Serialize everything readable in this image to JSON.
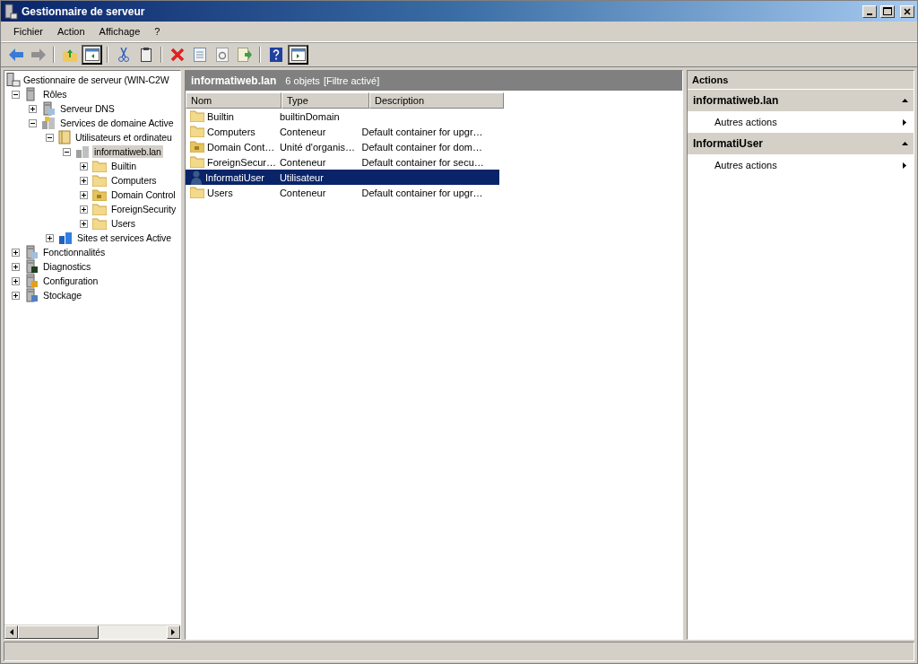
{
  "window": {
    "title": "Gestionnaire de serveur"
  },
  "menu": [
    "Fichier",
    "Action",
    "Affichage",
    "?"
  ],
  "toolbar": [
    {
      "kind": "back",
      "pressed": false,
      "disabled": false
    },
    {
      "kind": "forward",
      "pressed": false,
      "disabled": true
    },
    {
      "kind": "separator"
    },
    {
      "kind": "up",
      "pressed": false
    },
    {
      "kind": "tree",
      "pressed": true
    },
    {
      "kind": "separator"
    },
    {
      "kind": "cut",
      "pressed": false
    },
    {
      "kind": "paste",
      "pressed": false
    },
    {
      "kind": "separator"
    },
    {
      "kind": "delete",
      "pressed": false
    },
    {
      "kind": "properties",
      "pressed": false
    },
    {
      "kind": "refresh",
      "pressed": false
    },
    {
      "kind": "export",
      "pressed": false
    },
    {
      "kind": "separator"
    },
    {
      "kind": "help",
      "pressed": false
    },
    {
      "kind": "actionpane",
      "pressed": true
    }
  ],
  "tree": [
    {
      "label": "Gestionnaire de serveur (WIN-C2W",
      "kind": "server",
      "selected": false,
      "children": [
        {
          "label": "Rôles",
          "kind": "roles",
          "expanded": true,
          "selected": false,
          "children": [
            {
              "label": "Serveur DNS",
              "kind": "dns",
              "expanded": false,
              "selected": false
            },
            {
              "label": "Services de domaine Active",
              "kind": "ad",
              "expanded": true,
              "selected": false,
              "children": [
                {
                  "label": "Utilisateurs et ordinateu",
                  "kind": "book",
                  "expanded": true,
                  "selected": false,
                  "children": [
                    {
                      "label": "informatiweb.lan",
                      "kind": "domain",
                      "expanded": true,
                      "selected": true,
                      "children": [
                        {
                          "label": "Builtin",
                          "kind": "folder",
                          "expanded": false,
                          "selected": false
                        },
                        {
                          "label": "Computers",
                          "kind": "folder",
                          "expanded": false,
                          "selected": false
                        },
                        {
                          "label": "Domain Control",
                          "kind": "ou",
                          "expanded": false,
                          "selected": false
                        },
                        {
                          "label": "ForeignSecurity",
                          "kind": "folder",
                          "expanded": false,
                          "selected": false
                        },
                        {
                          "label": "Users",
                          "kind": "folder",
                          "expanded": false,
                          "selected": false
                        }
                      ]
                    }
                  ]
                },
                {
                  "label": "Sites et services Active",
                  "kind": "sites",
                  "expanded": false,
                  "selected": false
                }
              ]
            }
          ]
        },
        {
          "label": "Fonctionnalités",
          "kind": "features",
          "expanded": false,
          "selected": false
        },
        {
          "label": "Diagnostics",
          "kind": "diagnostics",
          "expanded": false,
          "selected": false
        },
        {
          "label": "Configuration",
          "kind": "config",
          "expanded": false,
          "selected": false
        },
        {
          "label": "Stockage",
          "kind": "storage",
          "expanded": false,
          "selected": false
        }
      ]
    }
  ],
  "list": {
    "title": "informatiweb.lan",
    "count": "6 objets",
    "filter": "[Filtre activé]",
    "columns": [
      "Nom",
      "Type",
      "Description"
    ],
    "rows": [
      {
        "kind": "folder",
        "name": "Builtin",
        "type": "builtinDomain",
        "selected": false
      },
      {
        "kind": "folder",
        "name": "Computers",
        "type": "Conteneur",
        "description": "Default container for upgr…",
        "selected": false
      },
      {
        "kind": "ou",
        "name": "Domain Cont…",
        "type": "Unité d'organis…",
        "description": "Default container for dom…",
        "selected": false
      },
      {
        "kind": "folder",
        "name": "ForeignSecur…",
        "type": "Conteneur",
        "description": "Default container for secu…",
        "selected": false
      },
      {
        "kind": "user",
        "name": "InformatiUser",
        "type": "Utilisateur",
        "selected": true
      },
      {
        "kind": "folder",
        "name": "Users",
        "type": "Conteneur",
        "description": "Default container for upgr…",
        "selected": false
      }
    ]
  },
  "actions": {
    "title": "Actions",
    "sections": [
      {
        "title": "informatiweb.lan",
        "expanded": true,
        "items": [
          "Autres actions"
        ]
      },
      {
        "title": "InformatiUser",
        "expanded": true,
        "items": [
          "Autres actions"
        ]
      }
    ]
  }
}
